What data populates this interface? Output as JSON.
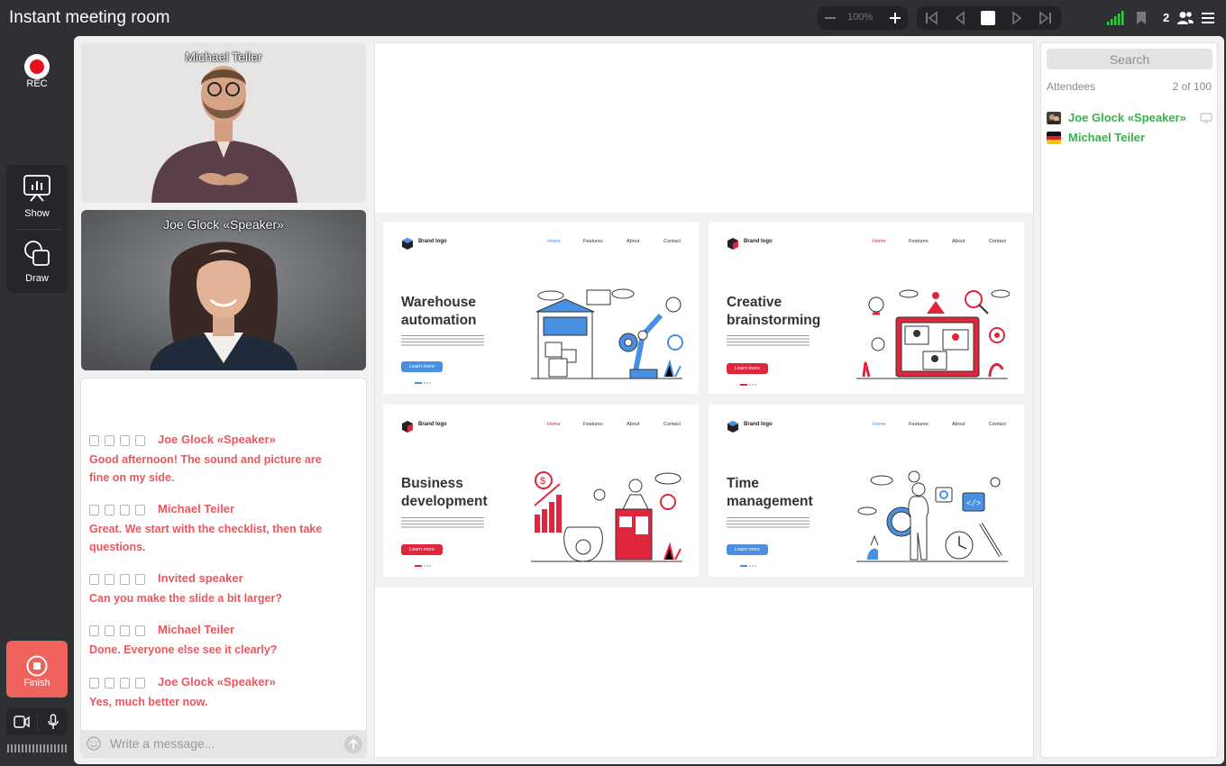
{
  "app": {
    "title": "Instant meeting room"
  },
  "toolbar": {
    "zoom_level": "100%",
    "attendee_count": "2",
    "colors": {
      "signal": "#2ecc40",
      "accent": "#e8585e"
    }
  },
  "rail": {
    "rec_label": "REC",
    "show_label": "Show",
    "draw_label": "Draw",
    "finish_label": "Finish"
  },
  "videos": [
    {
      "name": "Michael Teiler"
    },
    {
      "name": "Joe Glock «Speaker»"
    }
  ],
  "chat": {
    "messages": [
      {
        "author": "Joe Glock «Speaker»",
        "text": "Good afternoon! The sound and picture are fine on my side."
      },
      {
        "author": "Michael Teiler",
        "text": "Great. We start with the checklist, then take questions."
      },
      {
        "author": "Invited speaker",
        "text": "Can you make the slide a bit larger?"
      },
      {
        "author": "Michael Teiler",
        "text": "Done. Everyone else see it clearly?"
      },
      {
        "author": "Joe Glock «Speaker»",
        "text": "Yes, much better now."
      }
    ],
    "placeholder": "Write a message..."
  },
  "slides": [
    {
      "brand": "Brand logo",
      "nav": [
        "Home",
        "Features",
        "About",
        "Contact"
      ],
      "title": "Warehouse automation",
      "button": "Learn more",
      "theme": "#4a90e2",
      "illustration": "warehouse-robot-arm"
    },
    {
      "brand": "Brand logo",
      "nav": [
        "Home",
        "Features",
        "About",
        "Contact"
      ],
      "title": "Creative brainstorming",
      "button": "Learn more",
      "theme": "#e0263b",
      "illustration": "video-call-brainstorm"
    },
    {
      "brand": "Brand logo",
      "nav": [
        "Home",
        "Features",
        "About",
        "Contact"
      ],
      "title": "Business development",
      "button": "Learn more",
      "theme": "#e0263b",
      "illustration": "growth-chart-money"
    },
    {
      "brand": "Brand logo",
      "nav": [
        "Home",
        "Features",
        "About",
        "Contact"
      ],
      "title": "Time management",
      "button": "Learn more",
      "theme": "#4a90e2",
      "illustration": "magnifier-clock"
    }
  ],
  "attendees": {
    "search_placeholder": "Search",
    "label": "Attendees",
    "count": "2 of 100",
    "list": [
      {
        "name": "Joe Glock «Speaker»",
        "flag": "avatar",
        "status_icon": "screen-icon"
      },
      {
        "name": "Michael Teiler",
        "flag": "germany"
      }
    ]
  }
}
